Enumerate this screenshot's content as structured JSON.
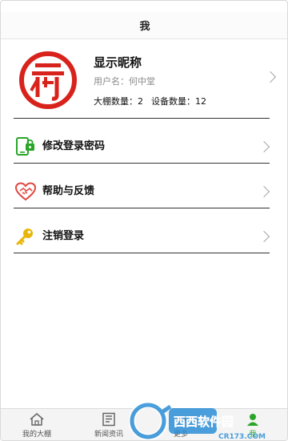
{
  "header": {
    "title": "我"
  },
  "profile": {
    "nickname": "显示昵称",
    "username": "用户名：何中堂",
    "greenhouse_count": "大棚数量：2",
    "device_count": "设备数量：12",
    "logo_icon": "red-gate-logo-icon"
  },
  "menu": [
    {
      "label": "修改登录密码",
      "icon": "phone-lock-icon",
      "color": "#2aa52a"
    },
    {
      "label": "帮助与反馈",
      "icon": "heart-handshake-icon",
      "color": "#e0463e"
    },
    {
      "label": "注销登录",
      "icon": "key-icon",
      "color": "#e8b60a"
    }
  ],
  "tabs": [
    {
      "label": "我的大棚",
      "icon": "home-icon"
    },
    {
      "label": "新闻资讯",
      "icon": "news-icon"
    },
    {
      "label": "更多",
      "icon": "more-icon"
    },
    {
      "label": "我",
      "icon": "user-icon"
    }
  ],
  "watermark": {
    "text": "西西软件园",
    "url_text": "CR173.COM"
  }
}
